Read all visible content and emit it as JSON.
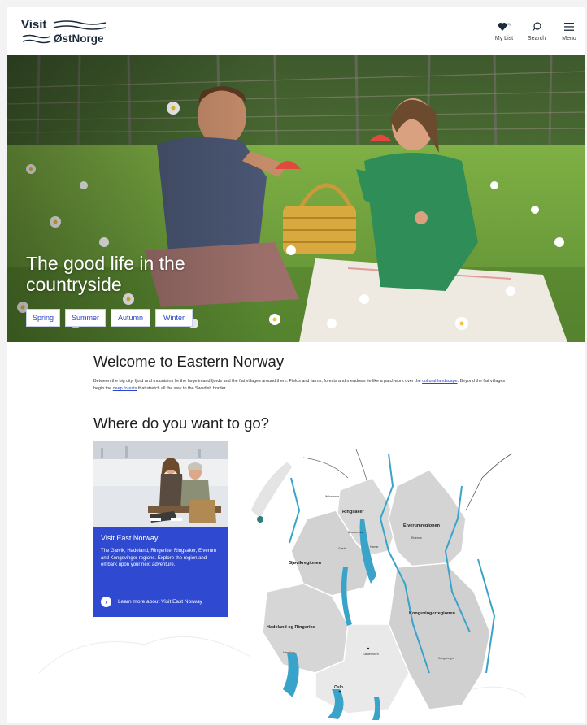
{
  "header": {
    "logo_word1": "Visit",
    "logo_word2": "ØstNorge",
    "nav": [
      {
        "label": "My List",
        "icon": "heart-icon"
      },
      {
        "label": "Search",
        "icon": "search-icon"
      },
      {
        "label": "Menu",
        "icon": "hamburger-menu-icon"
      }
    ]
  },
  "hero": {
    "title": "The good life in the countryside",
    "seasons": [
      "Spring",
      "Summer",
      "Autumn",
      "Winter"
    ]
  },
  "welcome": {
    "heading": "Welcome to Eastern Norway",
    "text_1": "Between the big city, fjord and mountains lie the large inland fjords and the flat villages around them. Fields and farms, forests and meadows lie like a patchwork over the ",
    "link_1": "cultural landscape",
    "text_2": ". Beyond the flat villages begin the ",
    "link_2": "deep forests",
    "text_3": " that stretch all the way to the Swedish border."
  },
  "where": {
    "heading": "Where do you want to go?"
  },
  "card": {
    "title": "Visit East Norway",
    "description": "The Gjøvik, Hadeland, Ringerike, Ringsaker, Elverum and Kongsvinger regions. Explore the region and embark upon your next adventure.",
    "link": "Learn more about Visit East Norway"
  },
  "map": {
    "regions": [
      "Ringsaker",
      "Elverumregionen",
      "Gjøvikregionen",
      "Kongsvingerregionen",
      "Hadeland og Ringerike"
    ],
    "places": [
      "Lillehammer",
      "Brumunddal",
      "Gjøvik",
      "Hamar",
      "Elverum",
      "Hønefoss",
      "Kongsvinger",
      "Oslo",
      "Gardermoen"
    ]
  },
  "colors": {
    "accent": "#2f4ad0",
    "link": "#2a47c8",
    "map_land": "#d9d9d9",
    "map_water": "#3aa3c9"
  }
}
